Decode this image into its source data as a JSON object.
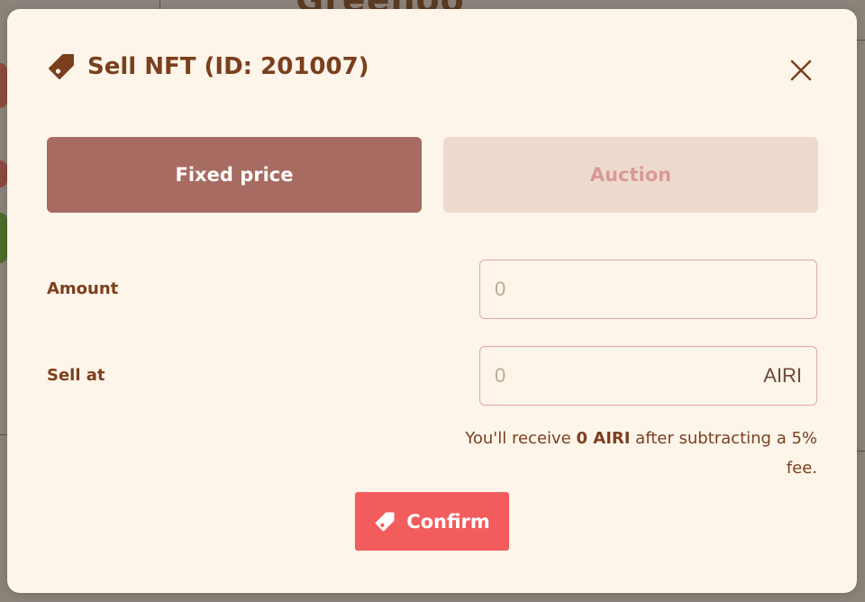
{
  "background": {
    "heading": "Greenoo"
  },
  "modal": {
    "title": "Sell NFT (ID: 201007)",
    "title_icon": "tag-icon",
    "close_icon": "close-icon"
  },
  "tabs": [
    {
      "label": "Fixed price",
      "active": true
    },
    {
      "label": "Auction",
      "active": false
    }
  ],
  "form": {
    "amount": {
      "label": "Amount",
      "value": "",
      "placeholder": "0"
    },
    "sell_at": {
      "label": "Sell at",
      "value": "",
      "placeholder": "0",
      "suffix": "AIRI"
    }
  },
  "receive_note": {
    "prefix": "You'll receive ",
    "amount": "0 AIRI",
    "suffix": " after subtracting a 5% fee."
  },
  "confirm": {
    "label": "Confirm",
    "icon": "tag-icon"
  },
  "colors": {
    "accent": "#f25c5c",
    "tab_active": "#a86b61",
    "tab_inactive": "#eedacd",
    "text_brown": "#7b3f1e",
    "modal_bg": "#fdf5ea"
  }
}
